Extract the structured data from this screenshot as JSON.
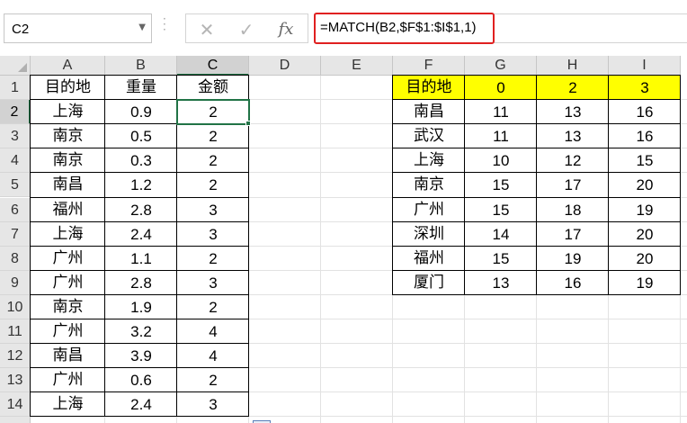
{
  "name_box": {
    "value": "C2"
  },
  "formula_bar": {
    "cancel_glyph": "✕",
    "enter_glyph": "✓",
    "fx_label": "fx",
    "formula": "=MATCH(B2,$F$1:$I$1,1)",
    "highlight_color": "#e02020"
  },
  "columns": [
    "A",
    "B",
    "C",
    "D",
    "E",
    "F",
    "G",
    "H",
    "I"
  ],
  "rows": [
    "1",
    "2",
    "3",
    "4",
    "5",
    "6",
    "7",
    "8",
    "9",
    "10",
    "11",
    "12",
    "13",
    "14"
  ],
  "selected_cell": "C2",
  "left_table": {
    "headers": [
      "目的地",
      "重量",
      "金额"
    ],
    "rows": [
      [
        "上海",
        "0.9",
        "2"
      ],
      [
        "南京",
        "0.5",
        "2"
      ],
      [
        "南京",
        "0.3",
        "2"
      ],
      [
        "南昌",
        "1.2",
        "2"
      ],
      [
        "福州",
        "2.8",
        "3"
      ],
      [
        "上海",
        "2.4",
        "3"
      ],
      [
        "广州",
        "1.1",
        "2"
      ],
      [
        "广州",
        "2.8",
        "3"
      ],
      [
        "南京",
        "1.9",
        "2"
      ],
      [
        "广州",
        "3.2",
        "4"
      ],
      [
        "南昌",
        "3.9",
        "4"
      ],
      [
        "广州",
        "0.6",
        "2"
      ],
      [
        "上海",
        "2.4",
        "3"
      ]
    ]
  },
  "right_table": {
    "header_fill": "#ffff00",
    "headers": [
      "目的地",
      "0",
      "2",
      "3"
    ],
    "rows": [
      [
        "南昌",
        "11",
        "13",
        "16"
      ],
      [
        "武汉",
        "11",
        "13",
        "16"
      ],
      [
        "上海",
        "10",
        "12",
        "15"
      ],
      [
        "南京",
        "15",
        "17",
        "20"
      ],
      [
        "广州",
        "15",
        "18",
        "19"
      ],
      [
        "深圳",
        "14",
        "17",
        "20"
      ],
      [
        "福州",
        "15",
        "19",
        "20"
      ],
      [
        "厦门",
        "13",
        "16",
        "19"
      ]
    ]
  },
  "colors": {
    "accent": "#217346",
    "header_bg": "#e6e6e6"
  }
}
